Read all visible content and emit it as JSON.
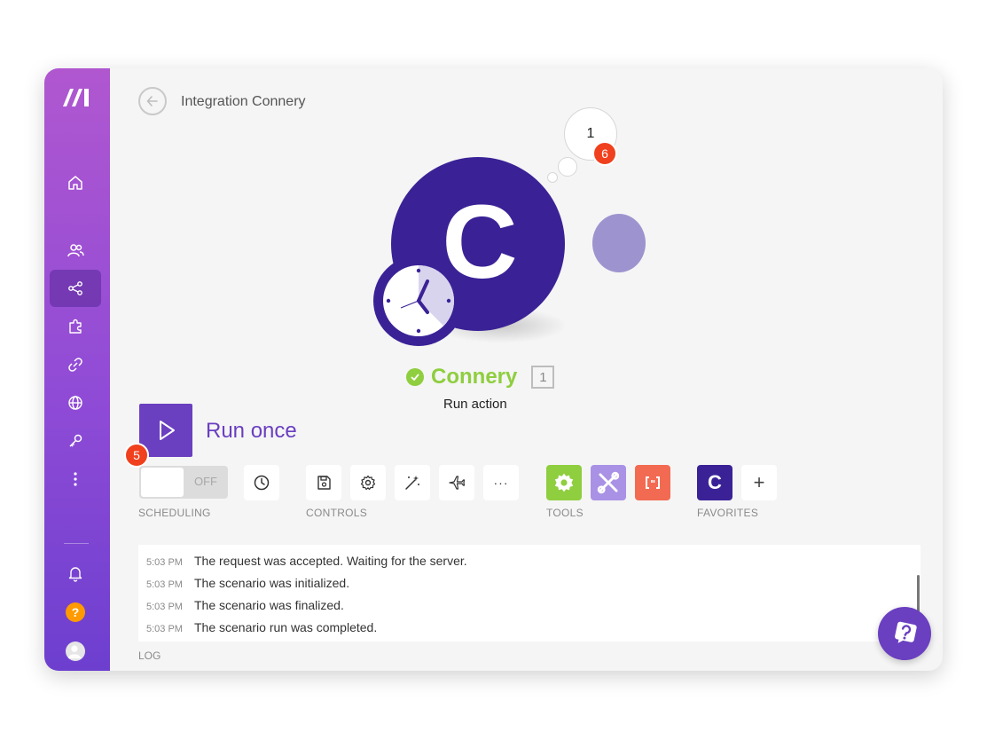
{
  "header": {
    "breadcrumb": "Integration Connery"
  },
  "node": {
    "letter": "C",
    "name": "Connery",
    "id": "1",
    "action": "Run action",
    "operations_count": "1",
    "badge_count": "6",
    "status": "success",
    "color": "#3a2296"
  },
  "run": {
    "label": "Run once",
    "badge_count": "5"
  },
  "scheduling": {
    "toggle_state": "OFF",
    "label": "SCHEDULING"
  },
  "controls": {
    "label": "CONTROLS",
    "more_glyph": "···"
  },
  "tools": {
    "label": "TOOLS",
    "colors": [
      "#8fce3f",
      "#a991e5",
      "#f26a52"
    ]
  },
  "favorites": {
    "label": "FAVORITES",
    "letter": "C",
    "add_glyph": "+"
  },
  "log": {
    "label": "LOG",
    "close_glyph": "×",
    "entries": [
      {
        "time": "5:03 PM",
        "message": "The request was accepted. Waiting for the server."
      },
      {
        "time": "5:03 PM",
        "message": "The scenario was initialized."
      },
      {
        "time": "5:03 PM",
        "message": "The scenario was finalized."
      },
      {
        "time": "5:03 PM",
        "message": "The scenario run was completed."
      }
    ]
  },
  "sidebar": {
    "help_glyph": "?",
    "items": [
      {
        "icon": "home-icon"
      },
      {
        "icon": "team-icon"
      },
      {
        "icon": "scenarios-icon",
        "active": true
      },
      {
        "icon": "apps-icon"
      },
      {
        "icon": "connections-icon"
      },
      {
        "icon": "webhooks-icon"
      },
      {
        "icon": "keys-icon"
      },
      {
        "icon": "more-icon"
      }
    ]
  },
  "colors": {
    "accent": "#6a3fc0",
    "success": "#8fce3f",
    "badge": "#f0401d"
  }
}
